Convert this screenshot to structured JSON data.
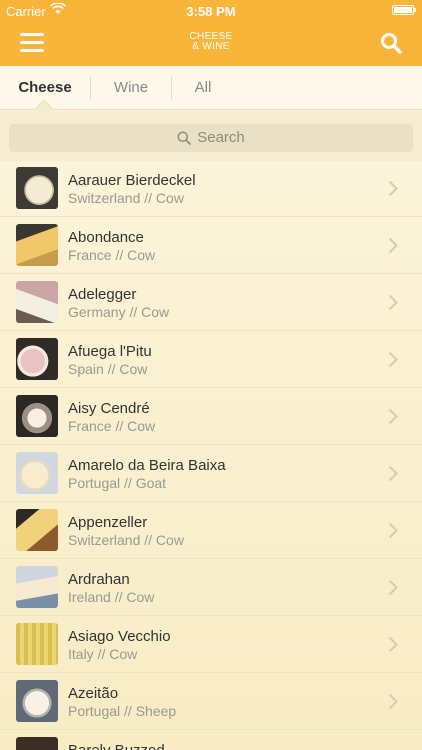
{
  "status_bar": {
    "carrier": "Carrier",
    "time": "3:58 PM"
  },
  "header": {
    "logo_line1": "CHEESE",
    "logo_line2": "& WINE"
  },
  "tabs": [
    {
      "label": "Cheese",
      "active": true
    },
    {
      "label": "Wine",
      "active": false
    },
    {
      "label": "All",
      "active": false
    }
  ],
  "search": {
    "placeholder": "Search"
  },
  "cheeses": [
    {
      "name": "Aarauer Bierdeckel",
      "meta": "Switzerland // Cow"
    },
    {
      "name": "Abondance",
      "meta": "France // Cow"
    },
    {
      "name": "Adelegger",
      "meta": "Germany // Cow"
    },
    {
      "name": "Afuega l'Pitu",
      "meta": "Spain // Cow"
    },
    {
      "name": "Aisy Cendré",
      "meta": "France // Cow"
    },
    {
      "name": "Amarelo da Beira Baixa",
      "meta": "Portugal // Goat"
    },
    {
      "name": "Appenzeller",
      "meta": "Switzerland // Cow"
    },
    {
      "name": "Ardrahan",
      "meta": "Ireland // Cow"
    },
    {
      "name": "Asiago Vecchio",
      "meta": "Italy // Cow"
    },
    {
      "name": "Azeitão",
      "meta": "Portugal // Sheep"
    },
    {
      "name": "Barely Buzzed",
      "meta": ""
    }
  ],
  "colors": {
    "accent": "#f9b43a",
    "background": "#fdf6e0"
  }
}
